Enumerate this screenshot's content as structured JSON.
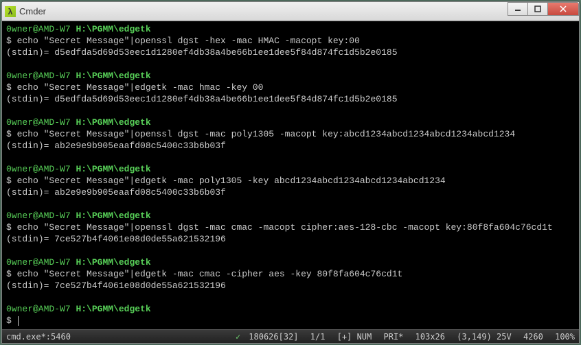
{
  "window": {
    "title": "Cmder",
    "icon_glyph": "λ"
  },
  "prompt": {
    "user_host": "0wner@AMD-W7",
    "path": "H:\\PGMM\\edgetk",
    "symbol": "$"
  },
  "blocks": [
    {
      "cmd": "echo \"Secret Message\"|openssl dgst -hex -mac HMAC -macopt key:00",
      "out": "(stdin)= d5edfda5d69d53eec1d1280ef4db38a4be66b1ee1dee5f84d874fc1d5b2e0185"
    },
    {
      "cmd": "echo \"Secret Message\"|edgetk -mac hmac -key 00",
      "out": "(stdin)= d5edfda5d69d53eec1d1280ef4db38a4be66b1ee1dee5f84d874fc1d5b2e0185"
    },
    {
      "cmd": "echo \"Secret Message\"|openssl dgst -mac poly1305 -macopt key:abcd1234abcd1234abcd1234abcd1234",
      "out": "(stdin)= ab2e9e9b905eaafd08c5400c33b6b03f"
    },
    {
      "cmd": "echo \"Secret Message\"|edgetk -mac poly1305 -key abcd1234abcd1234abcd1234abcd1234",
      "out": "(stdin)= ab2e9e9b905eaafd08c5400c33b6b03f"
    },
    {
      "cmd": "echo \"Secret Message\"|openssl dgst -mac cmac -macopt cipher:aes-128-cbc -macopt key:80f8fa604c76cd1t",
      "out": "(stdin)= 7ce527b4f4061e08d0de55a621532196"
    },
    {
      "cmd": "echo \"Secret Message\"|edgetk -mac cmac -cipher aes -key 80f8fa604c76cd1t",
      "out": "(stdin)= 7ce527b4f4061e08d0de55a621532196"
    }
  ],
  "statusbar": {
    "left": "cmd.exe*:5460",
    "info": "180626[32]",
    "pages": "1/1",
    "caps": "[+] NUM",
    "pri": "PRI*",
    "size": "103x26",
    "pos": "(3,149) 25V",
    "mem": "4260",
    "zoom": "100%"
  }
}
